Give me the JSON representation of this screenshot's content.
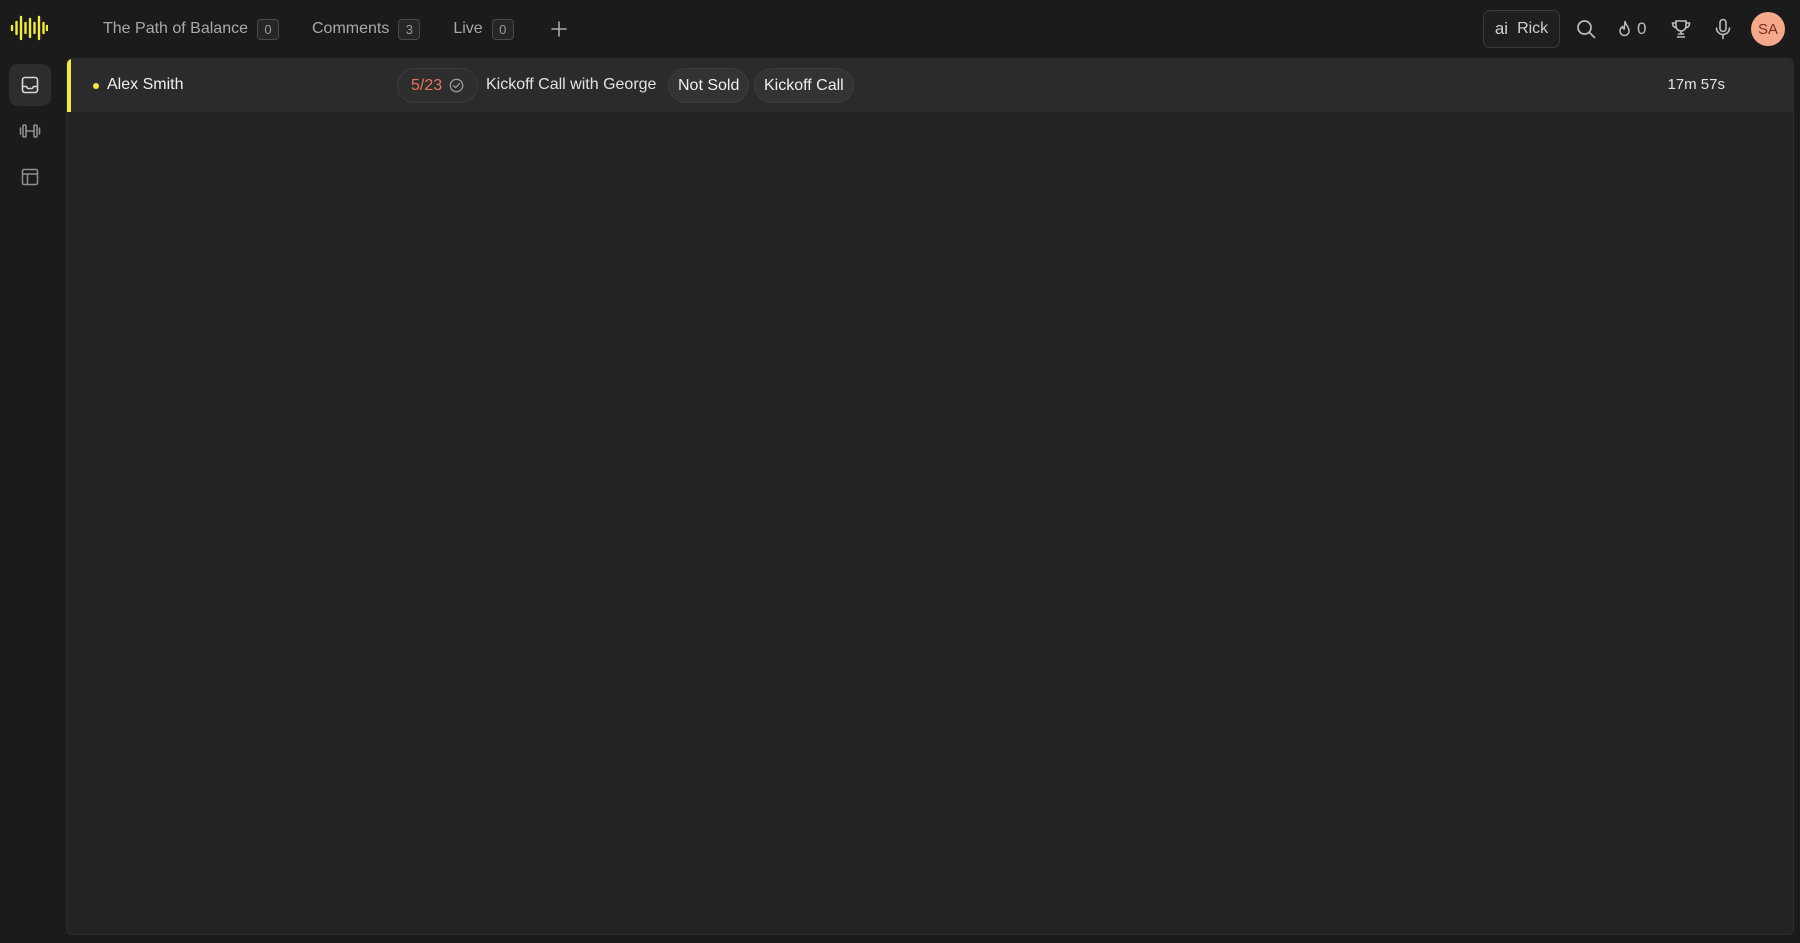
{
  "header": {
    "logo_icon": "soundwave-logo-icon",
    "tabs": [
      {
        "label": "The Path of Balance",
        "count": "0"
      },
      {
        "label": "Comments",
        "count": "3"
      },
      {
        "label": "Live",
        "count": "0"
      }
    ],
    "add_tab_icon": "plus-icon",
    "ai": {
      "mark": "ai",
      "name": "Rick"
    },
    "streak_count": "0",
    "avatar_initials": "SA"
  },
  "sidebar": {
    "items": [
      {
        "icon": "inbox-icon",
        "active": true
      },
      {
        "icon": "dumbbell-icon",
        "active": false
      },
      {
        "icon": "layout-icon",
        "active": false
      }
    ]
  },
  "list": {
    "rows": [
      {
        "name": "Alex Smith",
        "score": "5/23",
        "title": "Kickoff Call with George",
        "tags": [
          "Not Sold",
          "Kickoff Call"
        ],
        "duration": "17m 57s"
      }
    ]
  },
  "colors": {
    "accent": "#f2e94e",
    "score": "#e8735a",
    "avatar": "#f4a98c"
  }
}
